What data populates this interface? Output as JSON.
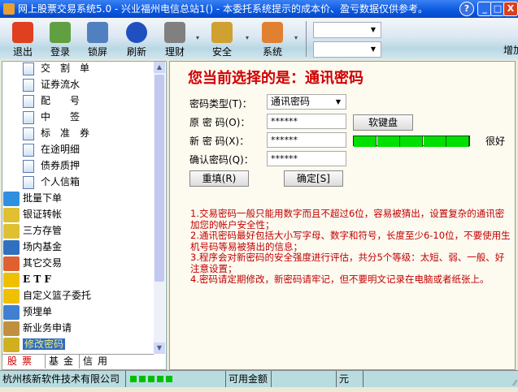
{
  "window": {
    "title": "网上股票交易系统5.0 - 兴业福州电信总站1() - 本委托系统提示的成本价、盈亏数据仅供参考。",
    "help": "?",
    "minimize": "_",
    "maximize": "□",
    "close": "X"
  },
  "toolbar": {
    "items": [
      {
        "label": "退出",
        "icon": "power-icon",
        "color": "#e04020"
      },
      {
        "label": "登录",
        "icon": "users-icon",
        "color": "#60a040"
      },
      {
        "label": "锁屏",
        "icon": "lock-screen-icon",
        "color": "#5080c0"
      },
      {
        "label": "刷新",
        "icon": "refresh-icon",
        "color": "#2050c0"
      },
      {
        "label": "理财",
        "icon": "finance-icon",
        "color": "#808080"
      },
      {
        "label": "安全",
        "icon": "keys-icon",
        "color": "#d0a030"
      },
      {
        "label": "系统",
        "icon": "tools-icon",
        "color": "#e08030"
      }
    ],
    "arrow": "▾",
    "combo1": "",
    "combo2": "",
    "combo_arrow": "▼",
    "right_label": "增加"
  },
  "sidebar": {
    "sub_items": [
      "交　割　单",
      "证券流水",
      "配　　号",
      "中　　签",
      "标　准　券",
      "在途明细",
      "债券质押",
      "个人信箱"
    ],
    "main_items": [
      {
        "label": "批量下单",
        "color": "#3090e0"
      },
      {
        "label": "银证转帐",
        "color": "#e0c030"
      },
      {
        "label": "三方存管",
        "color": "#e0c030"
      },
      {
        "label": "场内基金",
        "color": "#3070c0"
      },
      {
        "label": "其它交易",
        "color": "#e06030"
      },
      {
        "label": "E T F",
        "color": "#f0c000"
      },
      {
        "label": "自定义篮子委托",
        "color": "#f0c000"
      },
      {
        "label": "预埋单",
        "color": "#4080d0"
      },
      {
        "label": "新业务申请",
        "color": "#c09040"
      },
      {
        "label": "修改密码",
        "color": "#d0b020",
        "selected": true
      }
    ],
    "tabs": [
      "股票",
      "基金",
      "信用"
    ],
    "active_tab": "股票"
  },
  "form": {
    "heading": "您当前选择的是：通讯密码",
    "type_label": "密码类型(T)：",
    "type_value": "通讯密码",
    "old_label": "原 密 码(O)：",
    "old_value": "******",
    "new_label": "新 密 码(X)：",
    "new_value": "******",
    "confirm_label": "确认密码(Q)：",
    "confirm_value": "******",
    "softkb_button": "软键盘",
    "strength_level": 5,
    "strength_max": 5,
    "strength_text": "很好",
    "reset_button": "重填(R)",
    "ok_button": "确定[S]"
  },
  "notes": [
    "1.交易密码一般只能用数字而且不超过6位，容易被猜出，设置复杂的通讯密",
    "加您的帐户安全性；",
    "2.通讯密码最好包括大小写字母、数字和符号，长度至少6-10位，不要使用生",
    "机号码等易被猜出的信息；",
    "3.程序会对新密码的安全强度进行评估，共分5个等级：太短、弱、一般、好",
    "注意设置；",
    "4.密码请定期修改，新密码请牢记，但不要明文记录在电脑或者纸张上。"
  ],
  "status": {
    "company": "杭州核新软件技术有限公司",
    "available_label": "可用金额",
    "available_value": "",
    "unit": "元"
  }
}
